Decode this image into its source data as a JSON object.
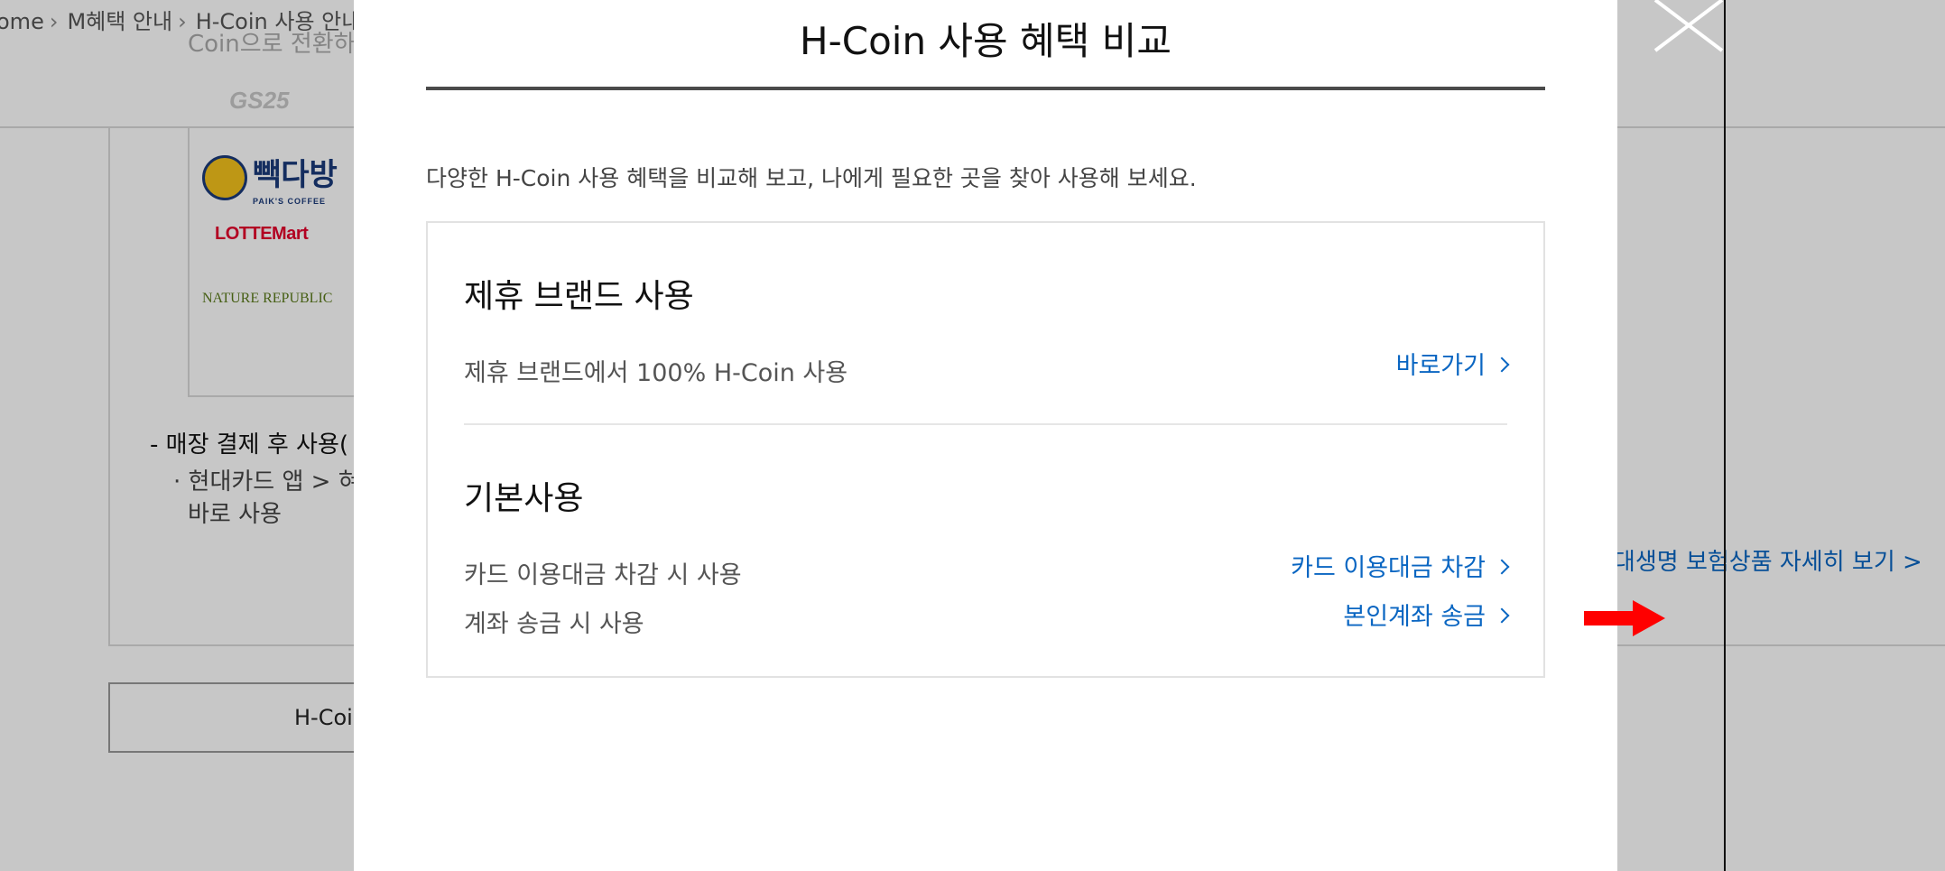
{
  "background": {
    "breadcrumb": [
      "ome",
      "M혜택 안내",
      "H-Coin 사용 안내"
    ],
    "sub_text": "Coin으로 전환하",
    "logos": {
      "gs25": "GS25",
      "paik_main": "빽다방",
      "paik_sub": "PAIK'S COFFEE",
      "lotte": "LOTTEMart",
      "nature": "NATURE REPUBLIC"
    },
    "list_title": "- 매장 결제 후 사용(",
    "list_item_line1": "· 현대카드 앱 > 혀",
    "list_item_line2": "바로 사용",
    "button_label": "H-Coi",
    "right_link": "현대생명 보험상품 자세히 보기 >"
  },
  "modal": {
    "title": "H-Coin 사용 혜택 비교",
    "description": "다양한 H-Coin 사용 혜택을 비교해 보고, 나에게 필요한 곳을 찾아 사용해 보세요.",
    "sections": [
      {
        "title": "제휴 브랜드 사용",
        "rows": [
          {
            "text": "제휴 브랜드에서 100% H-Coin 사용",
            "link": "바로가기"
          }
        ]
      },
      {
        "title": "기본사용",
        "rows": [
          {
            "text": "카드 이용대금 차감 시 사용",
            "link": "카드 이용대금 차감"
          },
          {
            "text": "계좌 송금 시 사용",
            "link": "본인계좌 송금"
          }
        ]
      }
    ]
  },
  "colors": {
    "link": "#0a66c2",
    "highlight_arrow": "#ff0000",
    "overlay": "rgba(0,0,0,0.22)"
  },
  "icons": {
    "close": "close-icon",
    "chevron": "chevron-right-icon",
    "annotation": "red-arrow-icon"
  }
}
